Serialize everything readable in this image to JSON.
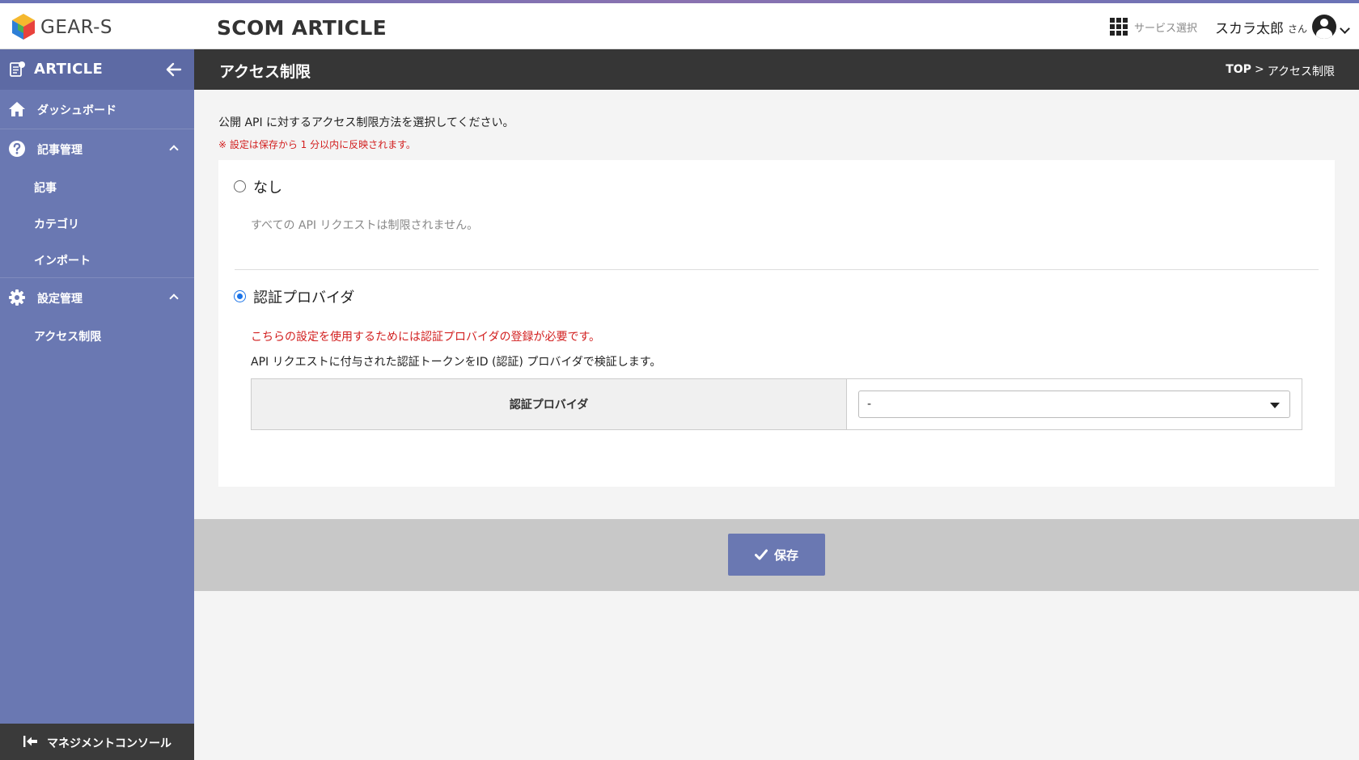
{
  "header": {
    "logo_text": "GEAR-S",
    "app_title": "SCOM ARTICLE",
    "service_select": "サービス選択",
    "user_name": "スカラ太郎",
    "user_suffix": "さん"
  },
  "sidebar": {
    "title": "ARTICLE",
    "items": [
      {
        "label": "ダッシュボード"
      },
      {
        "label": "記事管理",
        "children": [
          "記事",
          "カテゴリ",
          "インポート"
        ]
      },
      {
        "label": "設定管理",
        "children": [
          "アクセス制限"
        ]
      }
    ],
    "footer": "マネジメントコンソール"
  },
  "page": {
    "title": "アクセス制限",
    "breadcrumb": {
      "top": "TOP",
      "sep": ">",
      "current": "アクセス制限"
    },
    "intro": "公開 API に対するアクセス制限方法を選択してください。",
    "note": "※ 設定は保存から 1 分以内に反映されます。",
    "options": [
      {
        "label": "なし",
        "description": "すべての API リクエストは制限されません。",
        "selected": false
      },
      {
        "label": "認証プロバイダ",
        "selected": true,
        "warning": "こちらの設定を使用するためには認証プロバイダの登録が必要です。",
        "description": "API リクエストに付与された認証トークンをID (認証) プロバイダで検証します。"
      }
    ],
    "field": {
      "label": "認証プロバイダ",
      "value": "-"
    },
    "save_label": "保存"
  },
  "colors": {
    "sidebar": "#6a78b2",
    "accent": "#1a73e8",
    "warning": "#d21f1f",
    "titlebar": "#363636"
  }
}
